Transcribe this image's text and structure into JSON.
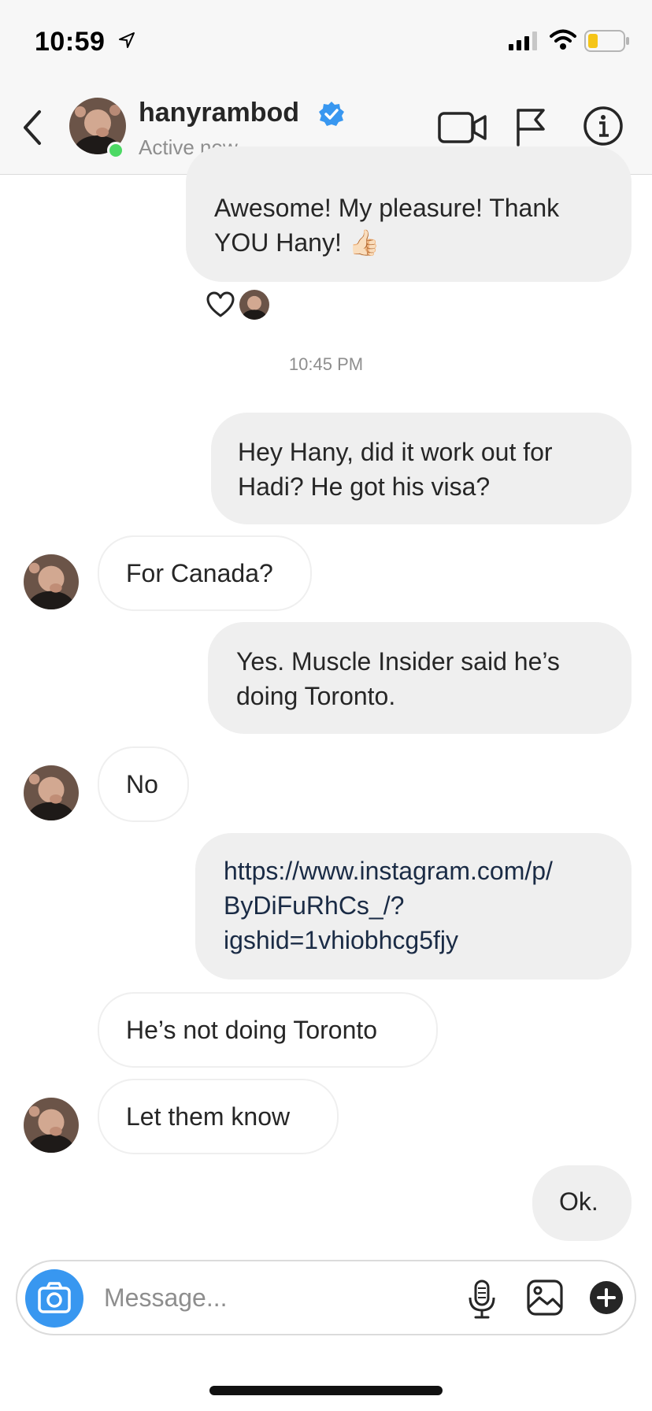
{
  "status_bar": {
    "time": "10:59"
  },
  "header": {
    "username": "hanyrambod",
    "active_status": "Active now"
  },
  "messages": [
    {
      "from": "me",
      "text_lines": [
        "Awesome! My pleasure! Thank",
        "YOU Hany! 👍🏻"
      ]
    },
    {
      "from": "me",
      "text_lines": [
        "Hey Hany, did it work out for",
        "Hadi? He got his visa?"
      ]
    },
    {
      "from": "them",
      "text_lines": [
        "For Canada?"
      ]
    },
    {
      "from": "me",
      "text_lines": [
        "Yes. Muscle Insider said he’s",
        "doing Toronto."
      ]
    },
    {
      "from": "them",
      "text_lines": [
        "No"
      ]
    },
    {
      "from": "me",
      "text_lines": [
        "https://www.instagram.com/p/",
        "ByDiFuRhCs_/?",
        "igshid=1vhiobhcg5fjy"
      ]
    },
    {
      "from": "them",
      "text_lines": [
        "He’s not doing Toronto"
      ]
    },
    {
      "from": "them",
      "text_lines": [
        "Let them know"
      ]
    },
    {
      "from": "me",
      "text_lines": [
        "Ok."
      ]
    }
  ],
  "timestamp": "10:45 PM",
  "composer": {
    "placeholder": "Message..."
  },
  "colors": {
    "accent": "#3897f0",
    "online": "#4cd964",
    "outgoing_bubble": "#efefef",
    "secondary_text": "#8e8e8e"
  }
}
